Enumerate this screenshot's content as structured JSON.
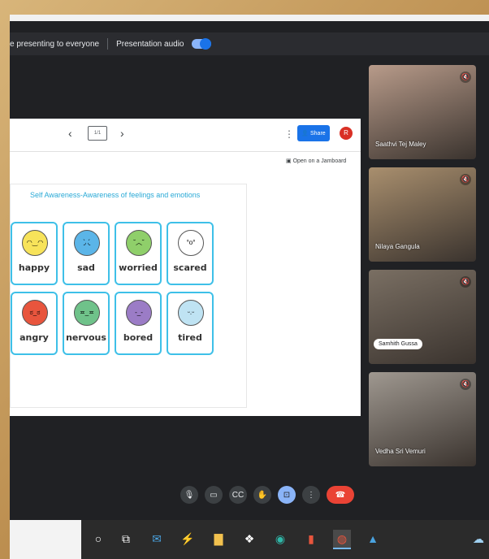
{
  "presentation_bar": {
    "status": "e presenting to everyone",
    "audio_label": "Presentation audio"
  },
  "slide": {
    "share_label": "Share",
    "avatar_initial": "R",
    "open_jamboard": "Open on a Jamboard",
    "frame_counter": "1/1",
    "card_title": "Self Awareness-Awareness of feelings and emotions",
    "emotions": [
      {
        "label": "happy",
        "color": "#f7e35a"
      },
      {
        "label": "sad",
        "color": "#5bb5e8"
      },
      {
        "label": "worried",
        "color": "#8fcf6a"
      },
      {
        "label": "scared",
        "color": "#ffffff"
      },
      {
        "label": "angry",
        "color": "#e8553d"
      },
      {
        "label": "nervous",
        "color": "#6fc28a"
      },
      {
        "label": "bored",
        "color": "#9b7cc6"
      },
      {
        "label": "tired",
        "color": "#bfe3f3"
      }
    ]
  },
  "participants": [
    {
      "name": "Saathvi Tej Maley",
      "bg": "#b89b8a"
    },
    {
      "name": "Nilaya Gangula",
      "bg": "#a98f6e"
    },
    {
      "name": "Samhith Gussa",
      "bg": "#7a6f63"
    },
    {
      "name": "Vedha Sri Vemuri",
      "bg": "#9f9890"
    }
  ],
  "controls": {
    "mic": "mic-icon",
    "camera": "camera-icon",
    "captions": "captions-icon",
    "hand": "hand-icon",
    "present": "present-icon",
    "more": "more-icon",
    "end": "end-call-icon"
  }
}
